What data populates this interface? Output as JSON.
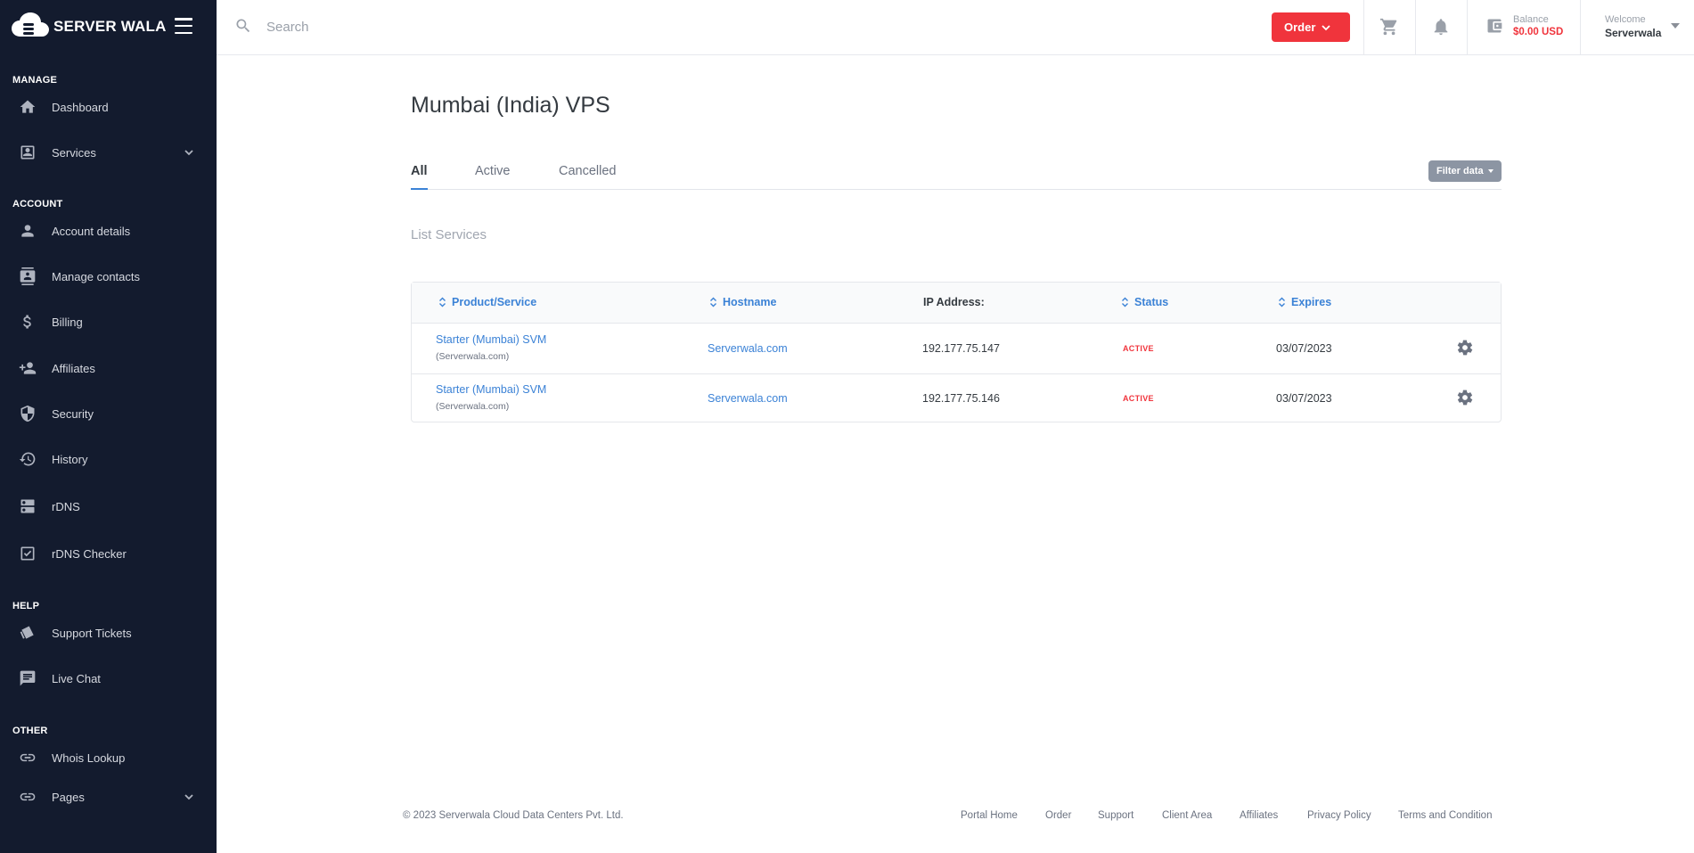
{
  "brand": {
    "name": "SERVER WALA"
  },
  "sidebar": {
    "sections": [
      {
        "title": "MANAGE"
      },
      {
        "title": "ACCOUNT"
      },
      {
        "title": "HELP"
      },
      {
        "title": "OTHER"
      }
    ],
    "items": [
      {
        "label": "Dashboard",
        "icon": "home-icon"
      },
      {
        "label": "Services",
        "icon": "contact-box-icon",
        "expandable": true
      },
      {
        "label": "Account details",
        "icon": "person-icon"
      },
      {
        "label": "Manage contacts",
        "icon": "contacts-icon"
      },
      {
        "label": "Billing",
        "icon": "dollar-icon"
      },
      {
        "label": "Affiliates",
        "icon": "person-add-icon"
      },
      {
        "label": "Security",
        "icon": "shield-icon"
      },
      {
        "label": "History",
        "icon": "history-icon"
      },
      {
        "label": "rDNS",
        "icon": "server-icon"
      },
      {
        "label": "rDNS Checker",
        "icon": "check-box-icon"
      },
      {
        "label": "Support Tickets",
        "icon": "tickets-icon"
      },
      {
        "label": "Live Chat",
        "icon": "chat-icon"
      },
      {
        "label": "Whois Lookup",
        "icon": "link-icon"
      },
      {
        "label": "Pages",
        "icon": "link-icon",
        "expandable": true
      }
    ]
  },
  "header": {
    "search_placeholder": "Search",
    "order_label": "Order",
    "balance_label": "Balance",
    "balance_value": "$0.00 USD",
    "welcome_label": "Welcome",
    "user_name": "Serverwala",
    "accent_color": "#f0343c"
  },
  "main": {
    "title": "Mumbai (India) VPS",
    "tabs": [
      {
        "label": "All",
        "active": true
      },
      {
        "label": "Active",
        "active": false
      },
      {
        "label": "Cancelled",
        "active": false
      }
    ],
    "filter_label": "Filter data",
    "list_title": "List Services",
    "table": {
      "columns": [
        "Product/Service",
        "Hostname",
        "IP Address:",
        "Status",
        "Expires"
      ],
      "rows": [
        {
          "product": "Starter (Mumbai) SVM",
          "domain": "(Serverwala.com)",
          "hostname": "Serverwala.com",
          "ip": "192.177.75.147",
          "status": "ACTIVE",
          "expires": "03/07/2023"
        },
        {
          "product": "Starter (Mumbai) SVM",
          "domain": "(Serverwala.com)",
          "hostname": "Serverwala.com",
          "ip": "192.177.75.146",
          "status": "ACTIVE",
          "expires": "03/07/2023"
        }
      ]
    }
  },
  "footer": {
    "copyright": "© 2023 Serverwala Cloud Data Centers Pvt. Ltd.",
    "links": [
      "Portal Home",
      "Order",
      "Support",
      "Client Area",
      "Affiliates",
      "Privacy Policy",
      "Terms and Condition"
    ]
  }
}
